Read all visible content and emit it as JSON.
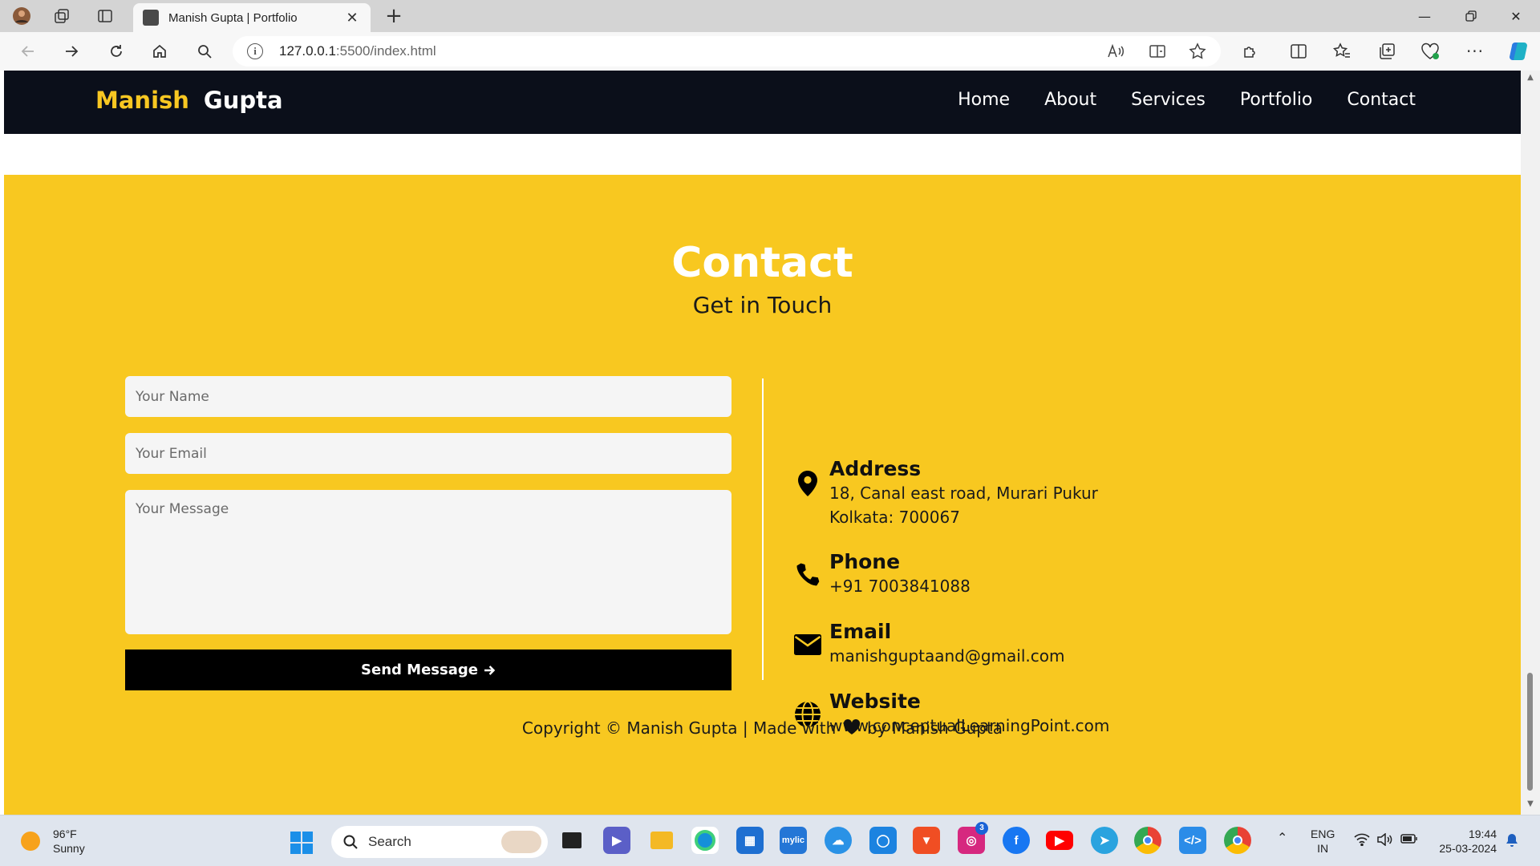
{
  "browser": {
    "tab_title": "Manish Gupta | Portfolio",
    "new_tab_symbol": "+",
    "url_host": "127.0.0.1",
    "url_path": ":5500/index.html",
    "icons": [
      "profile-icon",
      "workspaces-icon",
      "tab-actions-icon",
      "back-icon",
      "forward-icon",
      "refresh-icon",
      "home-icon",
      "search-icon",
      "site-info-icon",
      "read-aloud-icon",
      "immersive-reader-icon",
      "favorite-star-icon",
      "extensions-icon",
      "split-screen-icon",
      "favorites-icon",
      "collections-icon",
      "browser-essentials-icon",
      "more-icon",
      "copilot-icon"
    ]
  },
  "site": {
    "logo_first": "Manish",
    "logo_last": "Gupta",
    "nav": [
      "Home",
      "About",
      "Services",
      "Portfolio",
      "Contact"
    ],
    "colors": {
      "accent": "#f8c820",
      "header_bg": "#0b0f1a",
      "button_bg": "#000000"
    }
  },
  "contact": {
    "title": "Contact",
    "subtitle": "Get in Touch",
    "form": {
      "name_placeholder": "Your Name",
      "email_placeholder": "Your Email",
      "message_placeholder": "Your Message",
      "send_label": "Send Message"
    },
    "info": [
      {
        "icon": "map-pin-icon",
        "title": "Address",
        "lines": [
          "18, Canal east road, Murari Pukur",
          "Kolkata: 700067"
        ]
      },
      {
        "icon": "phone-icon",
        "title": "Phone",
        "lines": [
          "+91 7003841088"
        ]
      },
      {
        "icon": "envelope-icon",
        "title": "Email",
        "lines": [
          "manishguptaand@gmail.com"
        ]
      },
      {
        "icon": "globe-icon",
        "title": "Website",
        "lines": [
          "www.conceptualLearningPoint.com"
        ]
      }
    ],
    "copyright_before": "Copyright © Manish Gupta | Made with",
    "copyright_after": "by Manish Gupta"
  },
  "taskbar": {
    "weather_temp": "96°F",
    "weather_desc": "Sunny",
    "search_label": "Search",
    "language": "ENG",
    "region": "IN",
    "time": "19:44",
    "date": "25-03-2024",
    "notification_badge": "3"
  }
}
